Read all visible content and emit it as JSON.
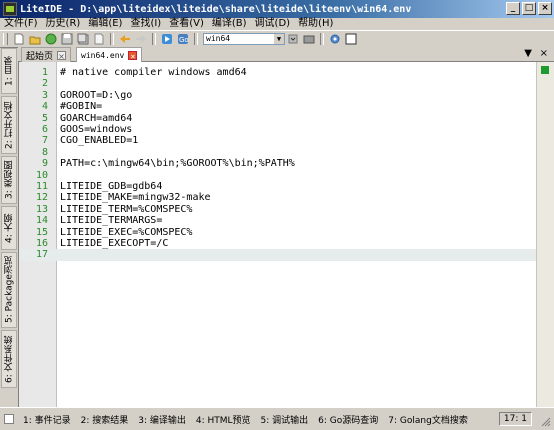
{
  "window": {
    "title": "LiteIDE - D:\\app\\liteidex\\liteide\\share\\liteide\\liteenv\\win64.env",
    "minimize_glyph": "_",
    "maximize_glyph": "□",
    "close_glyph": "×"
  },
  "menubar": {
    "items": [
      "文件(F)",
      "历史(R)",
      "编辑(E)",
      "查找(I)",
      "查看(V)",
      "编译(B)",
      "调试(D)",
      "帮助(H)"
    ]
  },
  "toolbar": {
    "env_select": "win64",
    "env_arrow": "▼"
  },
  "sidebar": {
    "tabs": [
      "1: 目录",
      "2: 打开文档",
      "3: 类视图",
      "4: 大纲",
      "5: Package浏览",
      "6: 文件系统"
    ]
  },
  "tabs": [
    {
      "label": "起始页",
      "active": false,
      "close": "×"
    },
    {
      "label": "win64.env",
      "active": true,
      "close": "×"
    }
  ],
  "tabbar_controls": {
    "list": "▼",
    "close": "×"
  },
  "editor": {
    "current_line": 17,
    "lines": [
      {
        "n": "1",
        "text": "# native compiler windows amd64"
      },
      {
        "n": "2",
        "text": ""
      },
      {
        "n": "3",
        "text": "GOROOT=D:\\go"
      },
      {
        "n": "4",
        "text": "#GOBIN="
      },
      {
        "n": "5",
        "text": "GOARCH=amd64"
      },
      {
        "n": "6",
        "text": "GOOS=windows"
      },
      {
        "n": "7",
        "text": "CGO_ENABLED=1"
      },
      {
        "n": "8",
        "text": ""
      },
      {
        "n": "9",
        "text": "PATH=c:\\mingw64\\bin;%GOROOT%\\bin;%PATH%"
      },
      {
        "n": "10",
        "text": ""
      },
      {
        "n": "11",
        "text": "LITEIDE_GDB=gdb64"
      },
      {
        "n": "12",
        "text": "LITEIDE_MAKE=mingw32-make"
      },
      {
        "n": "13",
        "text": "LITEIDE_TERM=%COMSPEC%"
      },
      {
        "n": "14",
        "text": "LITEIDE_TERMARGS="
      },
      {
        "n": "15",
        "text": "LITEIDE_EXEC=%COMSPEC%"
      },
      {
        "n": "16",
        "text": "LITEIDE_EXECOPT=/C"
      },
      {
        "n": "17",
        "text": ""
      }
    ]
  },
  "statusbar": {
    "items": [
      "1: 事件记录",
      "2: 搜索结果",
      "3: 编译输出",
      "4: HTML预览",
      "5: 调试输出",
      "6: Go源码查询",
      "7: Golang文档搜索"
    ],
    "position": "17: 1"
  },
  "colors": {
    "line_number": "#2a8a2a",
    "current_line_bg": "#e6ecec",
    "active_tab_close": "#e5572b",
    "scroll_marker": "#1f9b2e"
  }
}
